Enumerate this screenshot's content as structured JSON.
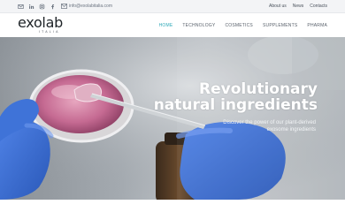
{
  "topbar": {
    "social_icons": [
      "envelope-icon",
      "linkedin-icon",
      "instagram-icon",
      "facebook-icon"
    ],
    "email": "info@exolabitalia.com",
    "links": [
      "About us",
      "News",
      "Contacts"
    ]
  },
  "header": {
    "logo_word": "exolab",
    "logo_sub": "ITALIA",
    "nav": [
      {
        "label": "HOME",
        "active": true
      },
      {
        "label": "TECHNOLOGY",
        "active": false
      },
      {
        "label": "COSMETICS",
        "active": false
      },
      {
        "label": "SUPPLEMENTS",
        "active": false
      },
      {
        "label": "PHARMA",
        "active": false
      }
    ]
  },
  "hero": {
    "title_line1": "Revolutionary",
    "title_line2": "natural ingredients",
    "subtitle_line1": "Discover the power of our plant-derived",
    "subtitle_line2": "exosome ingredients"
  },
  "colors": {
    "accent": "#2fa9b8",
    "glove": "#3d6fd6",
    "text_dark": "#1f2428"
  }
}
